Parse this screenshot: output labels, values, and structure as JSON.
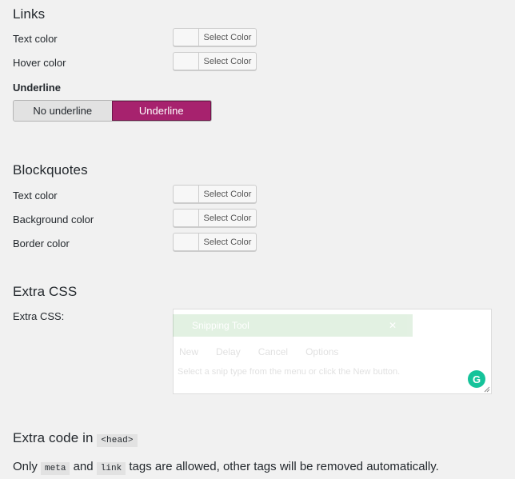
{
  "links": {
    "heading": "Links",
    "text_color_label": "Text color",
    "hover_color_label": "Hover color",
    "select_color_label": "Select Color",
    "underline_label": "Underline",
    "underline_options": [
      "No underline",
      "Underline"
    ],
    "underline_selected": "Underline"
  },
  "blockquotes": {
    "heading": "Blockquotes",
    "text_color_label": "Text color",
    "background_color_label": "Background color",
    "border_color_label": "Border color",
    "select_color_label": "Select Color"
  },
  "extra_css": {
    "heading": "Extra CSS",
    "field_label": "Extra CSS:",
    "value": ""
  },
  "ghost_window": {
    "title": "Snipping Tool",
    "items": [
      "New",
      "Delay",
      "Cancel",
      "Options"
    ],
    "hint": "Select a snip type from the menu or click the New button."
  },
  "extra_code": {
    "heading_prefix": "Extra code in",
    "heading_code": "<head>",
    "desc_1": "Only",
    "code_meta": "meta",
    "desc_2": "and",
    "code_link": "link",
    "desc_3": "tags are allowed, other tags will be removed automatically."
  },
  "colors": {
    "accent": "#a7226e",
    "grammarly": "#15c39a",
    "background": "#f1f1f1"
  }
}
